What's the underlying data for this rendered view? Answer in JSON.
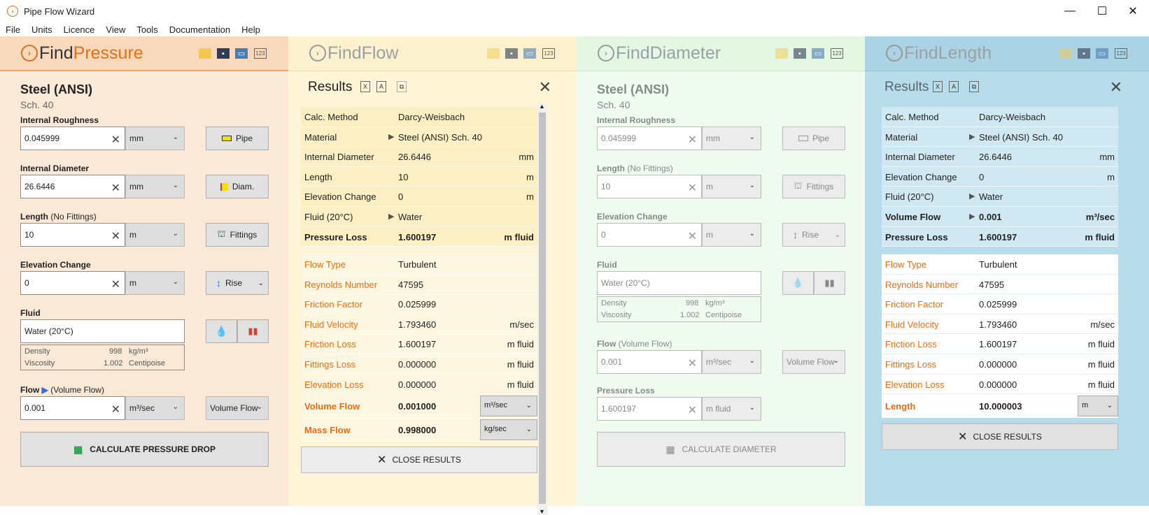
{
  "window": {
    "title": "Pipe Flow Wizard",
    "minimize": "—",
    "maximize": "☐",
    "close": "✕"
  },
  "menu": [
    "File",
    "Units",
    "Licence",
    "View",
    "Tools",
    "Documentation",
    "Help"
  ],
  "find_pressure": {
    "title_prefix": "Find",
    "title_highlight": "Pressure",
    "material": "Steel (ANSI)",
    "schedule": "Sch.  40",
    "roughness_label": "Internal Roughness",
    "roughness": "0.045999",
    "roughness_unit": "mm",
    "pipe_btn": "Pipe",
    "diameter_label": "Internal Diameter",
    "diameter": "26.6446",
    "diameter_unit": "mm",
    "diam_btn": "Diam.",
    "length_label": "Length",
    "length_sub": "(No Fittings)",
    "length": "10",
    "length_unit": "m",
    "fittings_btn": "Fittings",
    "elev_label": "Elevation Change",
    "elev": "0",
    "elev_unit": "m",
    "rise_btn": "Rise",
    "fluid_label": "Fluid",
    "fluid": "Water (20°C)",
    "density_label": "Density",
    "density": "998",
    "density_unit": "kg/m³",
    "viscosity_label": "Viscosity",
    "viscosity": "1.002",
    "viscosity_unit": "Centipoise",
    "flow_label": "Flow",
    "flow_sub": "(Volume Flow)",
    "flow": "0.001",
    "flow_unit": "m³/sec",
    "flow_type": "Volume Flow",
    "calc_btn": "CALCULATE PRESSURE DROP"
  },
  "find_flow": {
    "title": "FindFlow",
    "results_label": "Results",
    "rows_a": [
      {
        "k": "Calc. Method",
        "v": "Darcy-Weisbach",
        "u": ""
      },
      {
        "k": "Material",
        "v": "Steel (ANSI) Sch.  40",
        "u": ""
      },
      {
        "k": "Internal Diameter",
        "v": "26.6446",
        "u": "mm"
      },
      {
        "k": "Length",
        "v": "10",
        "u": "m"
      },
      {
        "k": "Elevation Change",
        "v": "0",
        "u": "m"
      },
      {
        "k": "Fluid (20°C)",
        "v": "Water",
        "u": ""
      },
      {
        "k": "Pressure Loss",
        "v": "1.600197",
        "u": "m fluid"
      }
    ],
    "rows_b": [
      {
        "k": "Flow Type",
        "v": "Turbulent",
        "u": ""
      },
      {
        "k": "Reynolds Number",
        "v": "47595",
        "u": ""
      },
      {
        "k": "Friction Factor",
        "v": "0.025999",
        "u": ""
      },
      {
        "k": "Fluid Velocity",
        "v": "1.793460",
        "u": "m/sec"
      },
      {
        "k": "Friction Loss",
        "v": "1.600197",
        "u": "m fluid"
      },
      {
        "k": "Fittings Loss",
        "v": "0.000000",
        "u": "m fluid"
      },
      {
        "k": "Elevation Loss",
        "v": "0.000000",
        "u": "m fluid"
      }
    ],
    "volume_flow": {
      "k": "Volume Flow",
      "v": "0.001000",
      "u": "m³/sec"
    },
    "mass_flow": {
      "k": "Mass Flow",
      "v": "0.998000",
      "u": "kg/sec"
    },
    "close_btn": "CLOSE RESULTS"
  },
  "find_diameter": {
    "title": "FindDiameter",
    "material": "Steel (ANSI)",
    "schedule": "Sch.  40",
    "roughness_label": "Internal Roughness",
    "roughness": "0.045999",
    "roughness_unit": "mm",
    "pipe_btn": "Pipe",
    "length_label": "Length",
    "length_sub": "(No Fittings)",
    "length": "10",
    "length_unit": "m",
    "fittings_btn": "Fittings",
    "elev_label": "Elevation Change",
    "elev": "0",
    "elev_unit": "m",
    "rise_btn": "Rise",
    "fluid_label": "Fluid",
    "fluid": "Water (20°C)",
    "density_label": "Density",
    "density": "998",
    "density_unit": "kg/m³",
    "viscosity_label": "Viscosity",
    "viscosity": "1.002",
    "viscosity_unit": "Centipoise",
    "flow_label": "Flow",
    "flow_sub": "(Volume Flow)",
    "flow": "0.001",
    "flow_unit": "m³/sec",
    "flow_type": "Volume Flow",
    "ploss_label": "Pressure Loss",
    "ploss": "1.600197",
    "ploss_unit": "m fluid",
    "calc_btn": "CALCULATE DIAMETER"
  },
  "find_length": {
    "title": "FindLength",
    "results_label": "Results",
    "rows_a": [
      {
        "k": "Calc. Method",
        "v": "Darcy-Weisbach",
        "u": ""
      },
      {
        "k": "Material",
        "v": "Steel (ANSI) Sch.  40",
        "u": ""
      },
      {
        "k": "Internal Diameter",
        "v": "26.6446",
        "u": "mm"
      },
      {
        "k": "Elevation Change",
        "v": "0",
        "u": "m"
      },
      {
        "k": "Fluid (20°C)",
        "v": "Water",
        "u": ""
      },
      {
        "k": "Volume Flow",
        "v": "0.001",
        "u": "m³/sec"
      },
      {
        "k": "Pressure Loss",
        "v": "1.600197",
        "u": "m fluid"
      }
    ],
    "rows_b": [
      {
        "k": "Flow Type",
        "v": "Turbulent",
        "u": ""
      },
      {
        "k": "Reynolds Number",
        "v": "47595",
        "u": ""
      },
      {
        "k": "Friction Factor",
        "v": "0.025999",
        "u": ""
      },
      {
        "k": "Fluid Velocity",
        "v": "1.793460",
        "u": "m/sec"
      },
      {
        "k": "Friction Loss",
        "v": "1.600197",
        "u": "m fluid"
      },
      {
        "k": "Fittings Loss",
        "v": "0.000000",
        "u": "m fluid"
      },
      {
        "k": "Elevation Loss",
        "v": "0.000000",
        "u": "m fluid"
      }
    ],
    "length_result": {
      "k": "Length",
      "v": "10.000003",
      "u": "m"
    },
    "close_btn": "CLOSE RESULTS"
  },
  "colors": {
    "accent": "#ea6d12",
    "pressure_bg": "#fbe9d7",
    "flow_bg": "#fdf5d5",
    "diameter_bg": "#effbef",
    "length_bg": "#b7dcea"
  }
}
